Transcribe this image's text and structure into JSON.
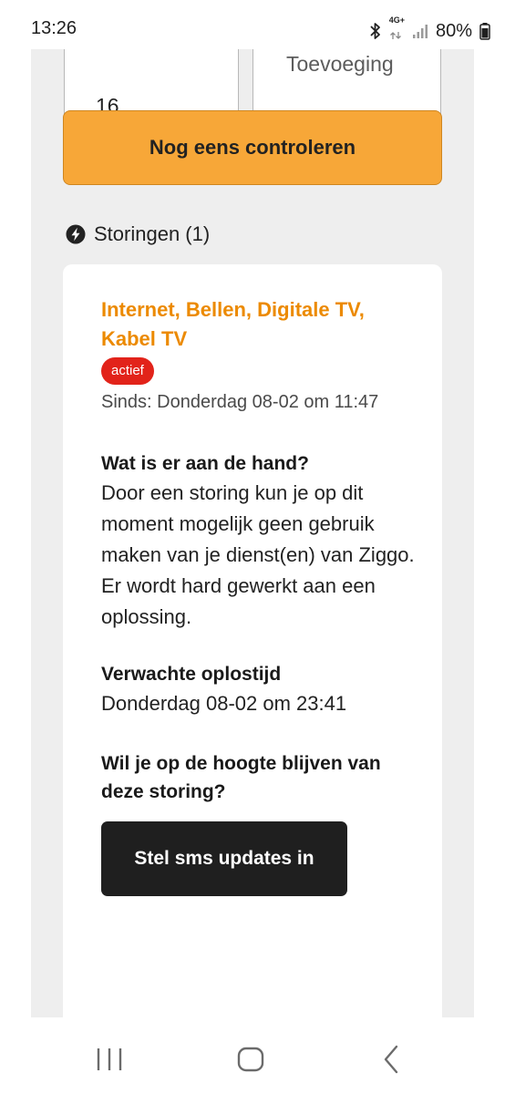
{
  "status_bar": {
    "time": "13:26",
    "network": "4G+",
    "battery": "80%"
  },
  "form": {
    "house_number_value": "16",
    "addition_placeholder": "Toevoeging",
    "check_button_label": "Nog eens controleren"
  },
  "outages": {
    "header": "Storingen (1)",
    "card": {
      "services": "Internet, Bellen, Digitale TV, Kabel TV",
      "status_badge": "actief",
      "since": "Sinds: Donderdag 08-02 om 11:47",
      "what_title": "Wat is er aan de hand?",
      "what_body": "Door een storing kun je op dit moment mogelijk geen gebruik maken van je dienst(en) van Ziggo. Er wordt hard gewerkt aan een oplossing.",
      "eta_title": "Verwachte oplostijd",
      "eta_value": "Donderdag 08-02 om 23:41",
      "updates_title": "Wil je op de hoogte blijven van deze storing?",
      "sms_button_label": "Stel sms updates in"
    }
  },
  "colors": {
    "accent_orange": "#f7a738",
    "title_orange": "#ec8a00",
    "badge_red": "#e2231a",
    "dark_button": "#1f1f1f"
  },
  "icons": {
    "section": "lightning-bolt-icon",
    "nav": [
      "recent-apps-icon",
      "home-icon",
      "back-icon"
    ]
  }
}
